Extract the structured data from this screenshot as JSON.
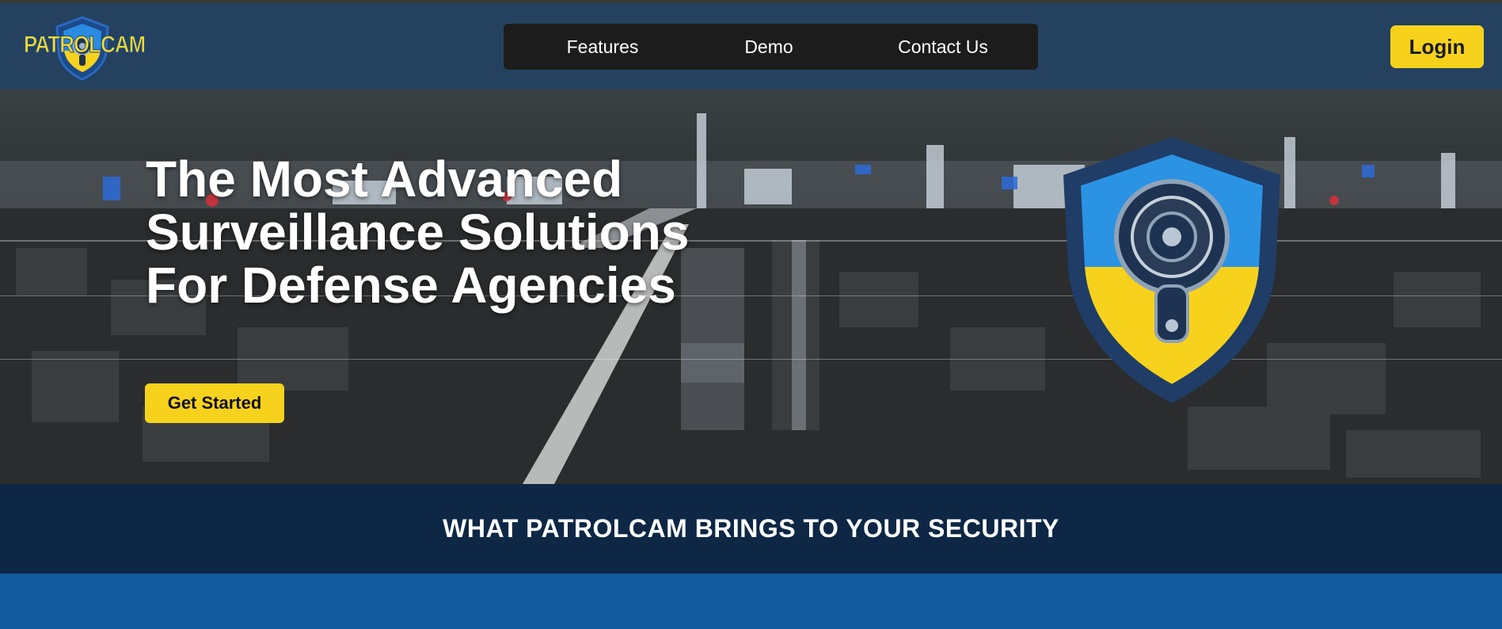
{
  "brand": {
    "logo_text": "PATROLCAM",
    "logo_icon": "shield-camera-icon",
    "accent": "#f7d21c",
    "header_bg": "#24425f"
  },
  "nav": {
    "items": [
      {
        "label": "Features"
      },
      {
        "label": "Demo"
      },
      {
        "label": "Contact Us"
      }
    ]
  },
  "header": {
    "login_label": "Login"
  },
  "hero": {
    "title": "The Most Advanced Surveillance Solutions For Defense Agencies",
    "cta_label": "Get Started",
    "background": "night city skyline photo",
    "emblem_icon": "shield-camera-emblem"
  },
  "section": {
    "title": "WHAT PATROLCAM BRINGS TO YOUR SECURITY",
    "bg": "#0d2745"
  }
}
